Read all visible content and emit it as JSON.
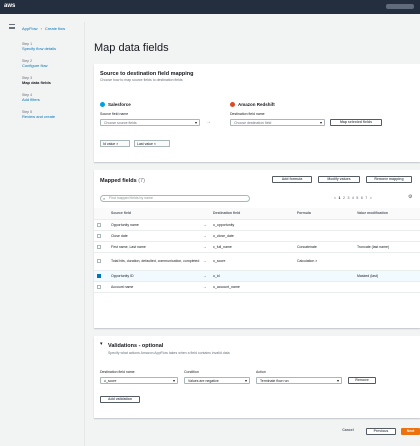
{
  "topbar": {
    "logo": "aws"
  },
  "breadcrumb": {
    "items": [
      "AppFlow",
      "Create flow"
    ],
    "current": ""
  },
  "steps": [
    {
      "num": "Step 1",
      "label": "Specify flow details"
    },
    {
      "num": "Step 2",
      "label": "Configure flow"
    },
    {
      "num": "Step 3",
      "label": "Map data fields"
    },
    {
      "num": "Step 4",
      "label": "Add filters"
    },
    {
      "num": "Step 5",
      "label": "Review and create"
    }
  ],
  "page_title": "Map data fields",
  "mapping_panel": {
    "title": "Source to destination field mapping",
    "subtitle": "Choose how to map source fields to destination fields",
    "source": {
      "name": "Salesforce",
      "field_label": "Source field name",
      "placeholder": "Choose source fields"
    },
    "destination": {
      "name": "Amazon Redshift",
      "field_label": "Destination field name",
      "placeholder": "Choose destination field",
      "button": "Map selected fields"
    },
    "tokens": [
      "Id value ×",
      "Last value ×"
    ]
  },
  "mapped_panel": {
    "title": "Mapped fields",
    "count": "(7)",
    "buttons": [
      "Add formula",
      "Modify values",
      "Remove mapping"
    ],
    "search_placeholder": "Find mapped fields by name",
    "pager": [
      "<",
      "1",
      "2",
      "3",
      "4",
      "5",
      "6",
      "7",
      ">"
    ],
    "columns": [
      "Source field",
      "Destination field",
      "Formula",
      "Value modification"
    ],
    "rows": [
      {
        "checked": false,
        "source": "Opportunity name",
        "dest": "o_opportunity",
        "formula": "",
        "modification": ""
      },
      {
        "checked": false,
        "source": "Close date",
        "dest": "o_close_date",
        "formula": "",
        "modification": ""
      },
      {
        "checked": false,
        "source": "First name, Last name",
        "dest": "c_full_name",
        "formula": "Concatenate",
        "modification": "Truncate (last name)"
      },
      {
        "checked": false,
        "source": "Total hits, duration, defaulted, communication, completed",
        "dest": "o_score",
        "formula": "Calculation ×",
        "modification": ""
      },
      {
        "checked": true,
        "source": "Opportunity ID",
        "dest": "o_id",
        "formula": "",
        "modification": "Masked (last)"
      },
      {
        "checked": false,
        "source": "Account name",
        "dest": "o_account_name",
        "formula": "",
        "modification": ""
      }
    ]
  },
  "validation_panel": {
    "title": "Validations - optional",
    "subtitle": "Specify what actions Amazon AppFlow takes when a field contains invalid data",
    "labels": [
      "Destination field name",
      "Condition",
      "Action"
    ],
    "values": [
      "o_score",
      "Values are negative",
      "Terminate flow run"
    ],
    "remove": "Remove",
    "add": "Add validation"
  },
  "footer": {
    "cancel": "Cancel",
    "previous": "Previous",
    "next": "Next"
  },
  "colors": {
    "accent": "#ec7211",
    "link": "#0073bb",
    "topbar": "#232f3e",
    "salesforce": "#00a1e0",
    "redshift": "#dd4b25"
  }
}
